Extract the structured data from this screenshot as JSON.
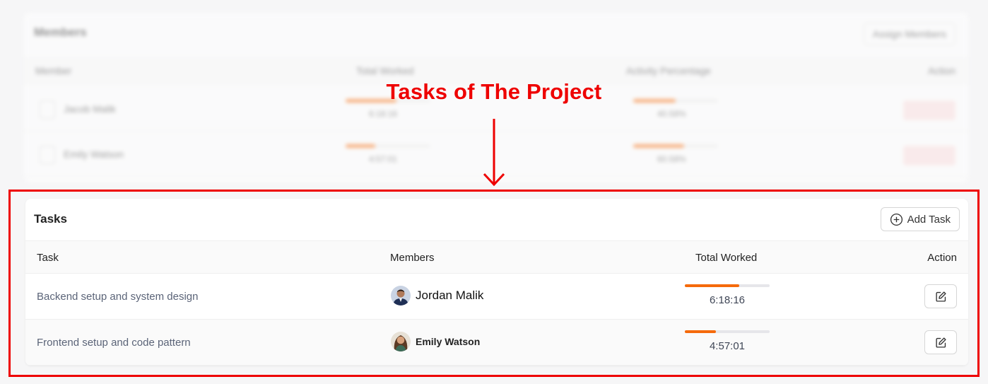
{
  "annotation": {
    "label": "Tasks of The Project"
  },
  "background_card": {
    "title": "Members",
    "button": "Assign Members",
    "columns": [
      "Member",
      "Total Worked",
      "Activity Percentage",
      "Action"
    ],
    "rows": [
      {
        "name": "Jacob Malik",
        "worked": "6:18:16",
        "worked_progress": 0.6,
        "activity": "40.58%",
        "activity_progress": 0.5
      },
      {
        "name": "Emily Watson",
        "worked": "4:57:01",
        "worked_progress": 0.35,
        "activity": "60.58%",
        "activity_progress": 0.6
      }
    ]
  },
  "tasks": {
    "title": "Tasks",
    "add_button": "Add Task",
    "add_icon": "plus-circle-icon",
    "columns": {
      "task": "Task",
      "members": "Members",
      "total_worked": "Total Worked",
      "action": "Action"
    },
    "rows": [
      {
        "task": "Backend setup and system design",
        "member": "Jordan Malik",
        "time": "6:18:16",
        "progress": 0.64,
        "action_icon": "edit-icon"
      },
      {
        "task": "Frontend setup and code pattern",
        "member": "Emily Watson",
        "time": "4:57:01",
        "progress": 0.37,
        "action_icon": "edit-icon"
      }
    ]
  },
  "colors": {
    "accent": "#f56a0b",
    "annotation": "#ee0000"
  }
}
